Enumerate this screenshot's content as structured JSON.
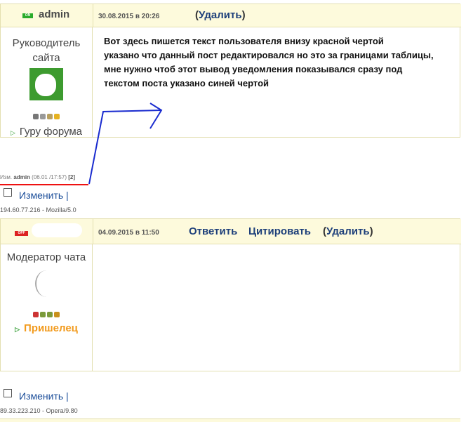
{
  "post1": {
    "username": "admin",
    "status_badge": "ON",
    "date": "30.08.2015 в 20:26",
    "delete_label": "Удалить",
    "role_line1": "Руководитель",
    "role_line2": "сайта",
    "rank": "Гуру форума",
    "body_lines": [
      "Вот здесь пишется текст пользователя внизу красной чертой",
      "указано что данный пост редактировался но это за границами таблицы,",
      "мне нужно чтоб этот вывод уведомления показывался сразу под",
      "текстом поста указано синей чертой"
    ],
    "edit_note_prefix": "Изм.",
    "edit_note_user": "admin",
    "edit_note_time": "(06.01 /17:57)",
    "edit_note_count": "[2]",
    "change_label": "Изменить",
    "separator": "|",
    "ip_line": "194.60.77.216 - Mozilla/5.0"
  },
  "post2": {
    "status_badge": "OFF",
    "date": "04.09.2015 в 11:50",
    "reply_label": "Ответить",
    "quote_label": "Цитировать",
    "delete_label": "Удалить",
    "role": "Модератор чата",
    "rank": "Пришелец",
    "change_label": "Изменить",
    "separator": "|",
    "ip_line": "89.33.223.210 - Opera/9.80"
  },
  "colors": {
    "header_bg": "#fdfadc",
    "link_blue": "#1d3f7a",
    "annotation_red": "#ee1111",
    "annotation_blue": "#1a2ccf",
    "online_green": "#2bab2b",
    "offline_red": "#dd2222",
    "rank_orange": "#f29a1c"
  }
}
